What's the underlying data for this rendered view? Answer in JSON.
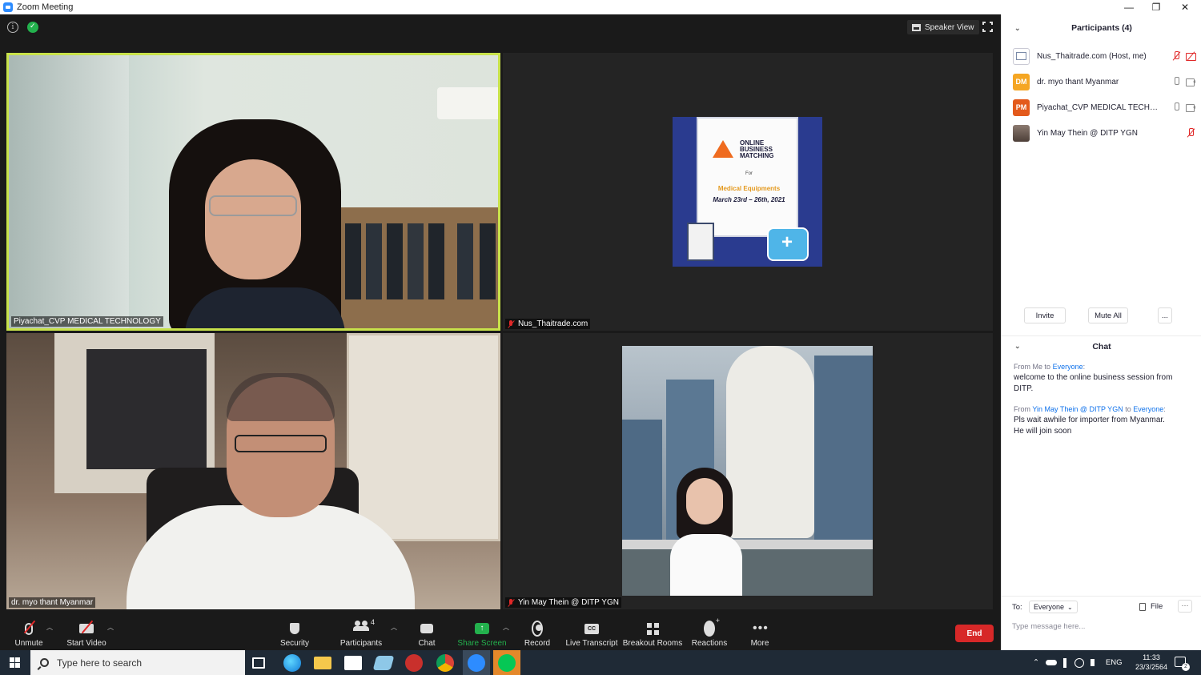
{
  "window": {
    "title": "Zoom Meeting",
    "minimize": "—",
    "restore": "❐",
    "close": "✕"
  },
  "topbar": {
    "info_glyph": "i",
    "speaker_view_label": "Speaker View"
  },
  "tiles": [
    {
      "name": "Piyachat_CVP MEDICAL TECHNOLOGY",
      "muted": false,
      "active_speaker": true
    },
    {
      "name": "Nus_Thaitrade.com",
      "muted": true,
      "active_speaker": false
    },
    {
      "name": "dr. myo thant Myanmar",
      "muted": false,
      "active_speaker": false
    },
    {
      "name": "Yin May Thein @ DITP YGN",
      "muted": true,
      "active_speaker": false
    }
  ],
  "poster": {
    "title": "ONLINE BUSINESS MATCHING",
    "for": "For",
    "category": "Medical Equipments",
    "dates": "March 23rd – 26th, 2021"
  },
  "toolbar": {
    "unmute": "Unmute",
    "start_video": "Start Video",
    "security": "Security",
    "participants": "Participants",
    "participant_count": "4",
    "chat": "Chat",
    "share_screen": "Share Screen",
    "record": "Record",
    "live_transcript": "Live Transcript",
    "cc_glyph": "CC",
    "breakout_rooms": "Breakout Rooms",
    "reactions": "Reactions",
    "more": "More",
    "end": "End",
    "share_color": "#23b14d",
    "end_color": "#d72828"
  },
  "participants_panel": {
    "title": "Participants (4)",
    "list": [
      {
        "name": "Nus_Thaitrade.com (Host, me)",
        "initials": "",
        "avatar_color": "#ffffff",
        "mic": "off",
        "video": "off"
      },
      {
        "name": "dr. myo thant Myanmar",
        "initials": "DM",
        "avatar_color": "#f5a623",
        "mic": "on",
        "video": "on"
      },
      {
        "name": "Piyachat_CVP MEDICAL TECHNOLOGY",
        "initials": "PM",
        "avatar_color": "#e35a1c",
        "mic": "on",
        "video": "on"
      },
      {
        "name": "Yin May Thein @ DITP YGN",
        "initials": "",
        "avatar_color": "#6b5a50",
        "mic": "off",
        "video": "none"
      }
    ],
    "invite": "Invite",
    "mute_all": "Mute All",
    "more": "..."
  },
  "chat_panel": {
    "title": "Chat",
    "messages": [
      {
        "from": "Me",
        "to": "Everyone",
        "from_prefix": "From",
        "to_word": "to",
        "text": "welcome to the online business session from DITP."
      },
      {
        "from": "Yin May Thein @ DITP YGN",
        "to": "Everyone",
        "from_prefix": "From",
        "to_word": "to",
        "text_lines": [
          "Pls wait awhile for importer from Myanmar.",
          "He will join soon"
        ]
      }
    ],
    "to_label": "To:",
    "to_value": "Everyone",
    "file_label": "File",
    "more_glyph": "···",
    "input_placeholder": "Type message here..."
  },
  "taskbar": {
    "search_placeholder": "Type here to search",
    "language": "ENG",
    "time": "11:33",
    "date": "23/3/2564",
    "notification_count": "2",
    "tray_up": "⌃"
  }
}
